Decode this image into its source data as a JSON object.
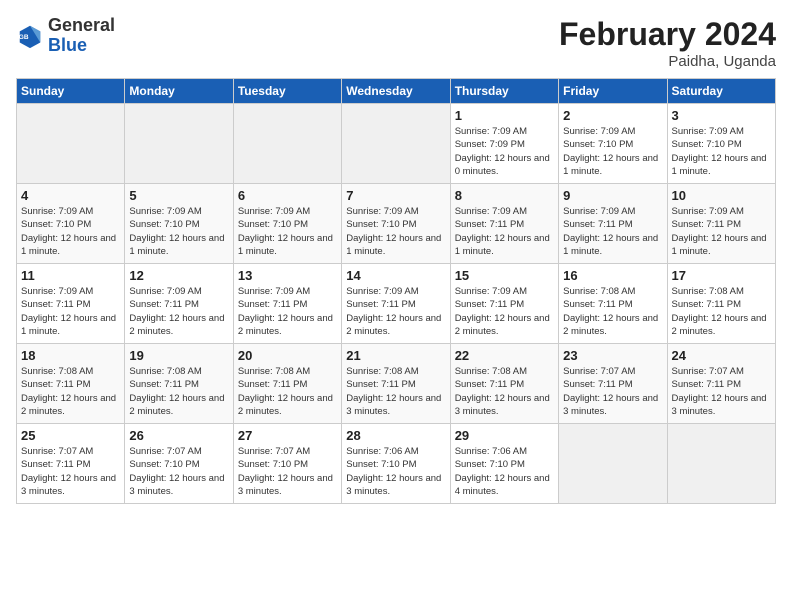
{
  "header": {
    "logo": {
      "general": "General",
      "blue": "Blue"
    },
    "title": "February 2024",
    "location": "Paidha, Uganda"
  },
  "calendar": {
    "days_of_week": [
      "Sunday",
      "Monday",
      "Tuesday",
      "Wednesday",
      "Thursday",
      "Friday",
      "Saturday"
    ],
    "weeks": [
      [
        {
          "day": "",
          "empty": true
        },
        {
          "day": "",
          "empty": true
        },
        {
          "day": "",
          "empty": true
        },
        {
          "day": "",
          "empty": true
        },
        {
          "day": "1",
          "sunrise": "7:09 AM",
          "sunset": "7:09 PM",
          "daylight": "12 hours and 0 minutes."
        },
        {
          "day": "2",
          "sunrise": "7:09 AM",
          "sunset": "7:10 PM",
          "daylight": "12 hours and 1 minute."
        },
        {
          "day": "3",
          "sunrise": "7:09 AM",
          "sunset": "7:10 PM",
          "daylight": "12 hours and 1 minute."
        }
      ],
      [
        {
          "day": "4",
          "sunrise": "7:09 AM",
          "sunset": "7:10 PM",
          "daylight": "12 hours and 1 minute."
        },
        {
          "day": "5",
          "sunrise": "7:09 AM",
          "sunset": "7:10 PM",
          "daylight": "12 hours and 1 minute."
        },
        {
          "day": "6",
          "sunrise": "7:09 AM",
          "sunset": "7:10 PM",
          "daylight": "12 hours and 1 minute."
        },
        {
          "day": "7",
          "sunrise": "7:09 AM",
          "sunset": "7:10 PM",
          "daylight": "12 hours and 1 minute."
        },
        {
          "day": "8",
          "sunrise": "7:09 AM",
          "sunset": "7:11 PM",
          "daylight": "12 hours and 1 minute."
        },
        {
          "day": "9",
          "sunrise": "7:09 AM",
          "sunset": "7:11 PM",
          "daylight": "12 hours and 1 minute."
        },
        {
          "day": "10",
          "sunrise": "7:09 AM",
          "sunset": "7:11 PM",
          "daylight": "12 hours and 1 minute."
        }
      ],
      [
        {
          "day": "11",
          "sunrise": "7:09 AM",
          "sunset": "7:11 PM",
          "daylight": "12 hours and 1 minute."
        },
        {
          "day": "12",
          "sunrise": "7:09 AM",
          "sunset": "7:11 PM",
          "daylight": "12 hours and 2 minutes."
        },
        {
          "day": "13",
          "sunrise": "7:09 AM",
          "sunset": "7:11 PM",
          "daylight": "12 hours and 2 minutes."
        },
        {
          "day": "14",
          "sunrise": "7:09 AM",
          "sunset": "7:11 PM",
          "daylight": "12 hours and 2 minutes."
        },
        {
          "day": "15",
          "sunrise": "7:09 AM",
          "sunset": "7:11 PM",
          "daylight": "12 hours and 2 minutes."
        },
        {
          "day": "16",
          "sunrise": "7:08 AM",
          "sunset": "7:11 PM",
          "daylight": "12 hours and 2 minutes."
        },
        {
          "day": "17",
          "sunrise": "7:08 AM",
          "sunset": "7:11 PM",
          "daylight": "12 hours and 2 minutes."
        }
      ],
      [
        {
          "day": "18",
          "sunrise": "7:08 AM",
          "sunset": "7:11 PM",
          "daylight": "12 hours and 2 minutes."
        },
        {
          "day": "19",
          "sunrise": "7:08 AM",
          "sunset": "7:11 PM",
          "daylight": "12 hours and 2 minutes."
        },
        {
          "day": "20",
          "sunrise": "7:08 AM",
          "sunset": "7:11 PM",
          "daylight": "12 hours and 2 minutes."
        },
        {
          "day": "21",
          "sunrise": "7:08 AM",
          "sunset": "7:11 PM",
          "daylight": "12 hours and 3 minutes."
        },
        {
          "day": "22",
          "sunrise": "7:08 AM",
          "sunset": "7:11 PM",
          "daylight": "12 hours and 3 minutes."
        },
        {
          "day": "23",
          "sunrise": "7:07 AM",
          "sunset": "7:11 PM",
          "daylight": "12 hours and 3 minutes."
        },
        {
          "day": "24",
          "sunrise": "7:07 AM",
          "sunset": "7:11 PM",
          "daylight": "12 hours and 3 minutes."
        }
      ],
      [
        {
          "day": "25",
          "sunrise": "7:07 AM",
          "sunset": "7:11 PM",
          "daylight": "12 hours and 3 minutes."
        },
        {
          "day": "26",
          "sunrise": "7:07 AM",
          "sunset": "7:10 PM",
          "daylight": "12 hours and 3 minutes."
        },
        {
          "day": "27",
          "sunrise": "7:07 AM",
          "sunset": "7:10 PM",
          "daylight": "12 hours and 3 minutes."
        },
        {
          "day": "28",
          "sunrise": "7:06 AM",
          "sunset": "7:10 PM",
          "daylight": "12 hours and 3 minutes."
        },
        {
          "day": "29",
          "sunrise": "7:06 AM",
          "sunset": "7:10 PM",
          "daylight": "12 hours and 4 minutes."
        },
        {
          "day": "",
          "empty": true
        },
        {
          "day": "",
          "empty": true
        }
      ]
    ]
  }
}
